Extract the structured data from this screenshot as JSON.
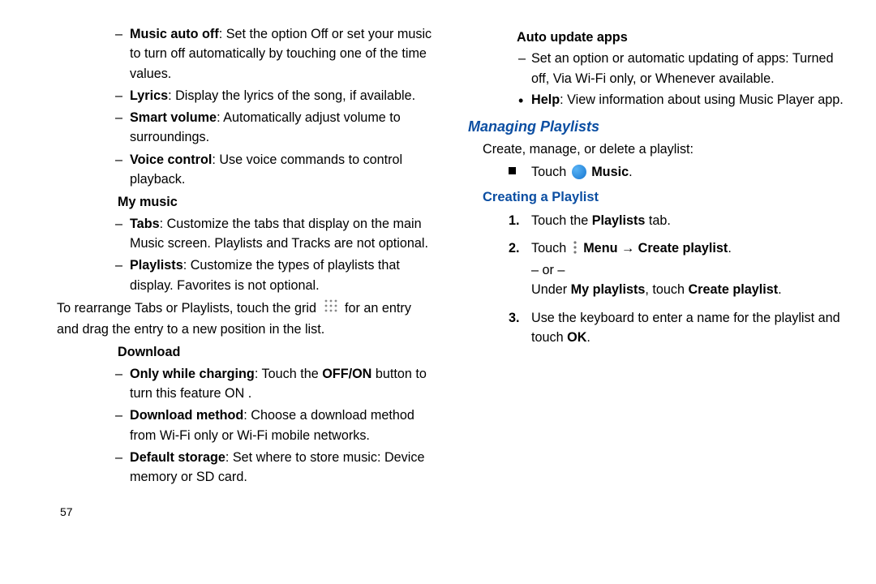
{
  "leftCol": {
    "items1": [
      {
        "bold": "Music auto off",
        "text": ": Set the option Off or set your music to turn off automatically by touching one of the time values."
      },
      {
        "bold": "Lyrics",
        "text": ": Display the lyrics of the song, if available."
      },
      {
        "bold": "Smart volume",
        "text": ": Automatically adjust volume to surroundings."
      },
      {
        "bold": "Voice control",
        "text": ": Use voice commands to control playback."
      }
    ],
    "myMusic": "My music",
    "items2": [
      {
        "bold": "Tabs",
        "text": ": Customize the tabs that display on the main Music screen. Playlists and Tracks are not optional."
      },
      {
        "bold": "Playlists",
        "text": ": Customize the types of playlists that display. Favorites is not optional."
      }
    ],
    "rearrange_a": "To rearrange Tabs or Playlists, touch the grid",
    "rearrange_b": "for an entry and drag the entry to a new position in the list.",
    "download": "Download",
    "items3_owc_b1": "Only while charging",
    "items3_owc_t1": ": Touch the ",
    "items3_owc_b2": "OFF/ON",
    "items3_owc_t2": " button to turn this feature ON .",
    "items3": [
      {
        "bold": "Download method",
        "text": ": Choose a download method from Wi-Fi only or Wi-Fi mobile networks."
      },
      {
        "bold": "Default storage",
        "text": ": Set where to store music: Device memory or SD card."
      }
    ],
    "pageNumber": "57"
  },
  "rightCol": {
    "autoUpdate": "Auto update apps",
    "autoUpdateText": "Set an option or automatic updating of apps: Turned off, Via Wi-Fi only, or Whenever available.",
    "help_b": "Help",
    "help_t": ": View information about using Music Player app.",
    "managing": "Managing Playlists",
    "createIntro": "Create, manage, or delete a playlist:",
    "touch": "Touch ",
    "music": "Music",
    "period": ".",
    "creating": "Creating a Playlist",
    "step1_a": "Touch the ",
    "step1_b": "Playlists",
    "step1_c": " tab.",
    "step2_touch": "Touch ",
    "step2_menu": "Menu",
    "step2_create": "Create playlist",
    "step2_or": "– or –",
    "step2_under": "Under ",
    "step2_myp": "My playlists",
    "step2_touch2": ", touch ",
    "step2_cp": "Create playlist",
    "step3_a": "Use the keyboard to enter a name for the playlist and touch ",
    "step3_b": "OK",
    "numbers": {
      "n1": "1.",
      "n2": "2.",
      "n3": "3."
    }
  }
}
